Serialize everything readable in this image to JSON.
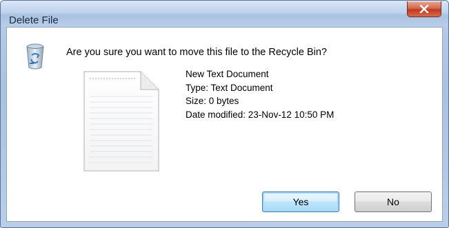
{
  "window": {
    "title": "Delete File",
    "close_label": "x"
  },
  "dialog": {
    "question": "Are you sure you want to move this file to the Recycle Bin?",
    "file": {
      "name": "New Text Document",
      "type": "Type: Text Document",
      "size": "Size: 0 bytes",
      "date_modified": "Date modified: 23-Nov-12 10:50 PM"
    },
    "icons": {
      "recycle_bin": "recycle-bin-icon",
      "file": "text-document-icon",
      "close": "close-icon"
    }
  },
  "buttons": {
    "yes_label": "Yes",
    "no_label": "No"
  },
  "colors": {
    "titlebar": "#bfd3ec",
    "close_button": "#c0381f",
    "default_button_border": "#3c7fb1"
  }
}
